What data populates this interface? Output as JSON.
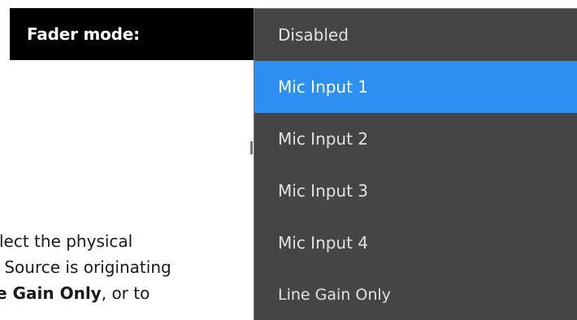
{
  "field": {
    "label": "Fader mode:"
  },
  "dropdown": {
    "selected": "Mic Input 1",
    "options": [
      "Disabled",
      "Mic Input 1",
      "Mic Input 2",
      "Mic Input 3",
      "Mic Input 4",
      "Line Gain Only"
    ]
  },
  "body_text": {
    "line1": "Select the physical",
    "line2": "he Source is originating",
    "line3_bold": "ine Gain Only",
    "line3_rest": ", or to"
  },
  "colors": {
    "label_background": "#000000",
    "dropdown_background": "#454545",
    "selected_background": "#2d8ff2",
    "option_text": "#e2e2e2"
  }
}
